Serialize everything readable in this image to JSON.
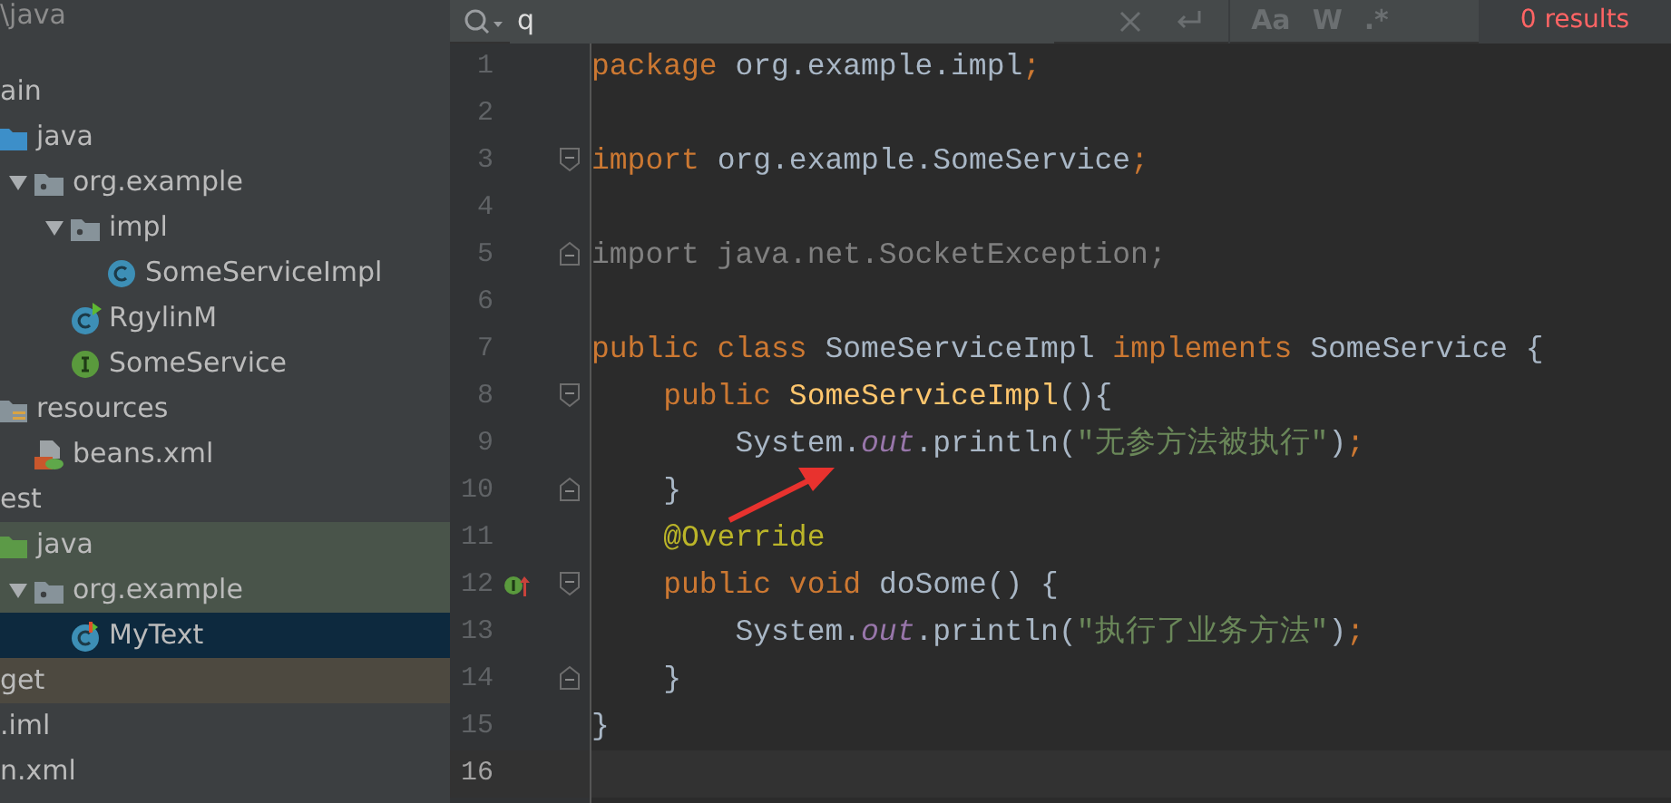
{
  "project_panel": {
    "path": "\\java",
    "tree": [
      {
        "label": "ain",
        "selected": false,
        "children": [
          {
            "label": "java",
            "kind": "source-folder",
            "selected": false,
            "children": [
              {
                "label": "org.example",
                "kind": "package",
                "expanded": true,
                "selected": false,
                "children": [
                  {
                    "label": "impl",
                    "kind": "package",
                    "expanded": true,
                    "selected": false,
                    "children": [
                      {
                        "label": "SomeServiceImpl",
                        "kind": "class",
                        "selected": false
                      }
                    ]
                  },
                  {
                    "label": "RgylinM",
                    "kind": "runnable-class",
                    "selected": false
                  },
                  {
                    "label": "SomeService",
                    "kind": "interface",
                    "selected": false
                  }
                ]
              }
            ]
          },
          {
            "label": "resources",
            "kind": "resources-folder",
            "selected": false,
            "children": [
              {
                "label": "beans.xml",
                "kind": "xml-file",
                "selected": false
              }
            ]
          }
        ]
      },
      {
        "label": "est",
        "selected": false,
        "children": [
          {
            "label": "java",
            "kind": "test-folder",
            "selected": false,
            "children": [
              {
                "label": "org.example",
                "kind": "test-package",
                "expanded": true,
                "selected": false,
                "children": [
                  {
                    "label": "MyText",
                    "kind": "test-class",
                    "selected": true
                  }
                ]
              }
            ]
          }
        ]
      },
      {
        "label": "get",
        "kind": "excluded-folder",
        "selected": false
      },
      {
        "label": ".iml",
        "selected": false
      },
      {
        "label": "n.xml",
        "selected": false
      }
    ]
  },
  "search": {
    "value": "q",
    "options": [
      "Aa",
      "W",
      ".*"
    ],
    "results": "0 results"
  },
  "editor": {
    "lines": [
      {
        "number": "1",
        "current": false,
        "fold_start": false,
        "fold_end": false,
        "implements_marker": false,
        "tokens": [
          {
            "kind": "keyword",
            "text": "package"
          },
          {
            "kind": "plain",
            "text": " org.example.impl"
          },
          {
            "kind": "keyword",
            "text": ";"
          }
        ]
      },
      {
        "number": "2",
        "current": false,
        "fold_start": false,
        "fold_end": false,
        "implements_marker": false
      },
      {
        "number": "3",
        "current": false,
        "fold_start": true,
        "fold_end": false,
        "implements_marker": false,
        "tokens": [
          {
            "kind": "keyword",
            "text": "import"
          },
          {
            "kind": "plain",
            "text": " org.example.SomeService"
          },
          {
            "kind": "keyword",
            "text": ";"
          }
        ]
      },
      {
        "number": "4",
        "current": false,
        "fold_start": false,
        "fold_end": false,
        "implements_marker": false
      },
      {
        "number": "5",
        "current": false,
        "fold_start": false,
        "fold_end": true,
        "implements_marker": false,
        "tokens": [
          {
            "kind": "unused",
            "text": "import java.net.SocketException;"
          }
        ]
      },
      {
        "number": "6",
        "current": false,
        "fold_start": false,
        "fold_end": false,
        "implements_marker": false
      },
      {
        "number": "7",
        "current": false,
        "fold_start": false,
        "fold_end": false,
        "implements_marker": false,
        "tokens": [
          {
            "kind": "keyword",
            "text": "public class "
          },
          {
            "kind": "plain",
            "text": "SomeServiceImpl "
          },
          {
            "kind": "keyword",
            "text": "implements "
          },
          {
            "kind": "plain",
            "text": "SomeService {"
          }
        ]
      },
      {
        "number": "8",
        "current": false,
        "fold_start": true,
        "fold_end": false,
        "implements_marker": false,
        "tokens": [
          {
            "kind": "keyword",
            "text": "    public "
          },
          {
            "kind": "method",
            "text": "SomeServiceImpl"
          },
          {
            "kind": "plain",
            "text": "(){"
          }
        ]
      },
      {
        "number": "9",
        "current": false,
        "fold_start": false,
        "fold_end": false,
        "implements_marker": false,
        "tokens": [
          {
            "kind": "plain",
            "text": "        System."
          },
          {
            "kind": "field",
            "text": "out"
          },
          {
            "kind": "plain",
            "text": ".println("
          },
          {
            "kind": "string",
            "text": "\"无参方法被执行\""
          },
          {
            "kind": "plain",
            "text": ")"
          },
          {
            "kind": "keyword",
            "text": ";"
          }
        ]
      },
      {
        "number": "10",
        "current": false,
        "fold_start": false,
        "fold_end": true,
        "implements_marker": false,
        "tokens": [
          {
            "kind": "plain",
            "text": "    }"
          }
        ]
      },
      {
        "number": "11",
        "current": false,
        "fold_start": false,
        "fold_end": false,
        "implements_marker": false,
        "tokens": [
          {
            "kind": "annotation",
            "text": "    @Override"
          }
        ]
      },
      {
        "number": "12",
        "current": false,
        "fold_start": true,
        "fold_end": false,
        "implements_marker": true,
        "tokens": [
          {
            "kind": "keyword",
            "text": "    public void "
          },
          {
            "kind": "plain",
            "text": "doSome() {"
          }
        ]
      },
      {
        "number": "13",
        "current": false,
        "fold_start": false,
        "fold_end": false,
        "implements_marker": false,
        "tokens": [
          {
            "kind": "plain",
            "text": "        System."
          },
          {
            "kind": "field",
            "text": "out"
          },
          {
            "kind": "plain",
            "text": ".println("
          },
          {
            "kind": "string",
            "text": "\"执行了业务方法\""
          },
          {
            "kind": "plain",
            "text": ")"
          },
          {
            "kind": "keyword",
            "text": ";"
          }
        ]
      },
      {
        "number": "14",
        "current": false,
        "fold_start": false,
        "fold_end": true,
        "implements_marker": false,
        "tokens": [
          {
            "kind": "plain",
            "text": "    }"
          }
        ]
      },
      {
        "number": "15",
        "current": false,
        "fold_start": false,
        "fold_end": false,
        "implements_marker": false,
        "tokens": [
          {
            "kind": "plain",
            "text": "}"
          }
        ]
      },
      {
        "number": "16",
        "current": true,
        "fold_start": false,
        "fold_end": false,
        "implements_marker": false
      }
    ]
  }
}
